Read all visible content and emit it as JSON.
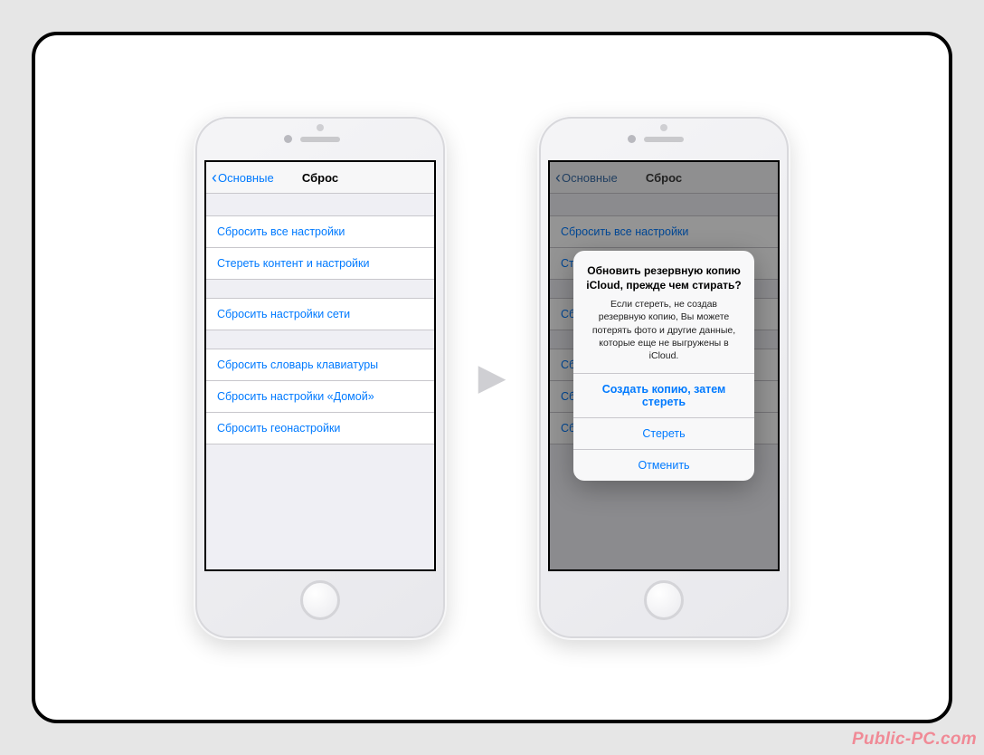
{
  "nav": {
    "back_label": "Основные",
    "title": "Сброс"
  },
  "reset_items": {
    "g1": [
      "Сбросить все настройки",
      "Стереть контент и настройки"
    ],
    "g2": [
      "Сбросить настройки сети"
    ],
    "g3": [
      "Сбросить словарь клавиатуры",
      "Сбросить настройки «Домой»",
      "Сбросить геонастройки"
    ]
  },
  "alert": {
    "title": "Обновить резервную копию iCloud, прежде чем стирать?",
    "message": "Если стереть, не создав резервную копию, Вы можете потерять фото и другие данные, которые еще не выгружены в iCloud.",
    "btn_backup": "Создать копию, затем стереть",
    "btn_erase": "Стереть",
    "btn_cancel": "Отменить"
  },
  "arrow_glyph": "▶",
  "watermark": "Public-PC.com"
}
